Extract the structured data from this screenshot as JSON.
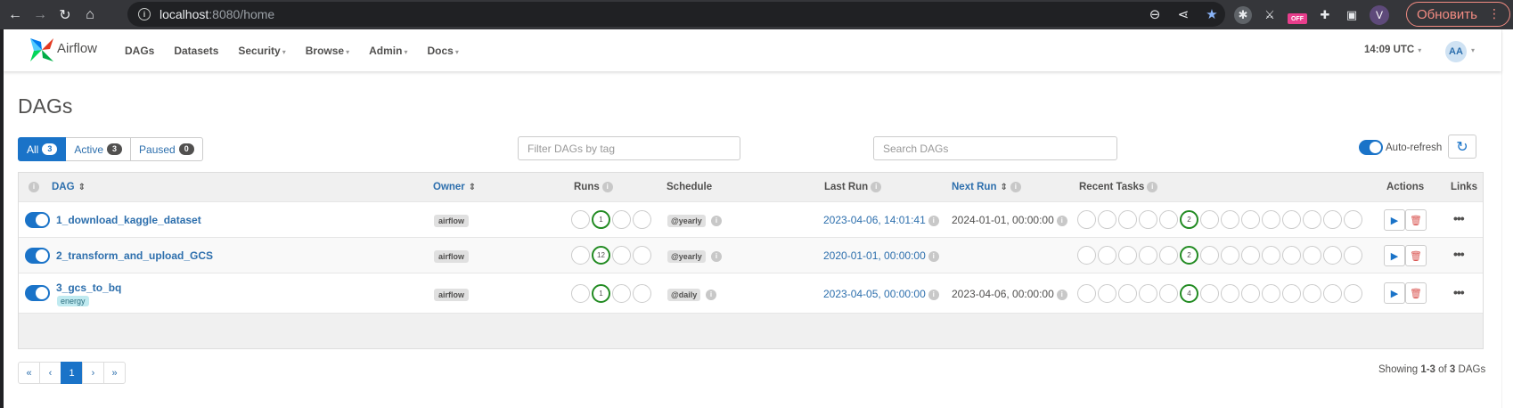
{
  "browser": {
    "url_host": "localhost",
    "url_rest": ":8080/home",
    "update_label": "Обновить",
    "avatar_letter": "V",
    "ext_badge": "OFF"
  },
  "navbar": {
    "brand": "Airflow",
    "menu": [
      "DAGs",
      "Datasets",
      "Security",
      "Browse",
      "Admin",
      "Docs"
    ],
    "time": "14:09 UTC",
    "user_initials": "AA"
  },
  "page_title": "DAGs",
  "filters": {
    "all_label": "All",
    "all_count": "3",
    "active_label": "Active",
    "active_count": "3",
    "paused_label": "Paused",
    "paused_count": "0"
  },
  "tag_filter_placeholder": "Filter DAGs by tag",
  "search_placeholder": "Search DAGs",
  "autorefresh_label": "Auto-refresh",
  "columns": {
    "dag": "DAG",
    "owner": "Owner",
    "runs": "Runs",
    "schedule": "Schedule",
    "last_run": "Last Run",
    "next_run": "Next Run",
    "recent_tasks": "Recent Tasks",
    "actions": "Actions",
    "links": "Links"
  },
  "dags": [
    {
      "name": "1_download_kaggle_dataset",
      "tag": "",
      "owner": "airflow",
      "runs_success": "1",
      "schedule": "@yearly",
      "last_run": "2023-04-06, 14:01:41",
      "next_run": "2024-01-01, 00:00:00",
      "task_success": "2"
    },
    {
      "name": "2_transform_and_upload_GCS",
      "tag": "",
      "owner": "airflow",
      "runs_success": "12",
      "schedule": "@yearly",
      "last_run": "2020-01-01, 00:00:00",
      "next_run": "",
      "task_success": "2"
    },
    {
      "name": "3_gcs_to_bq",
      "tag": "energy",
      "owner": "airflow",
      "runs_success": "1",
      "schedule": "@daily",
      "last_run": "2023-04-05, 00:00:00",
      "next_run": "2023-04-06, 00:00:00",
      "task_success": "4"
    }
  ],
  "pagination": [
    "«",
    "‹",
    "1",
    "›",
    "»"
  ],
  "showing": {
    "prefix": "Showing ",
    "range": "1-3",
    "mid": " of ",
    "total": "3",
    "suffix": " DAGs"
  }
}
